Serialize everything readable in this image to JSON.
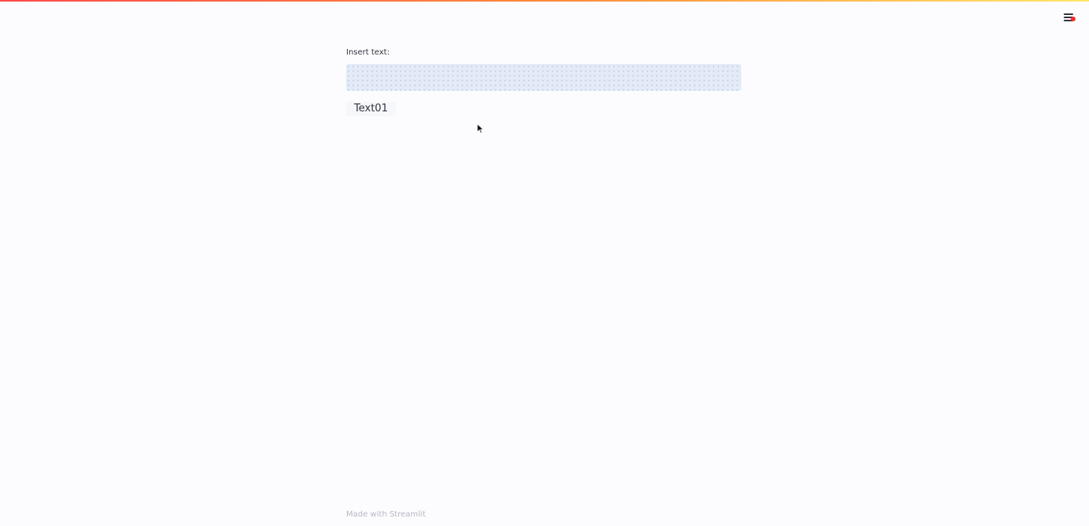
{
  "app": {
    "menu_icon": "hamburger-menu-icon",
    "menu_badge_color": "#ff2b2b",
    "decoration_colors": [
      "#ff4b4b",
      "#ff8a3d",
      "#ffe66d"
    ]
  },
  "main": {
    "input_label": "Insert text:",
    "input_value": "",
    "input_placeholder": "",
    "output_text": "Text01"
  },
  "footer": {
    "text": "Made with Streamlit"
  }
}
